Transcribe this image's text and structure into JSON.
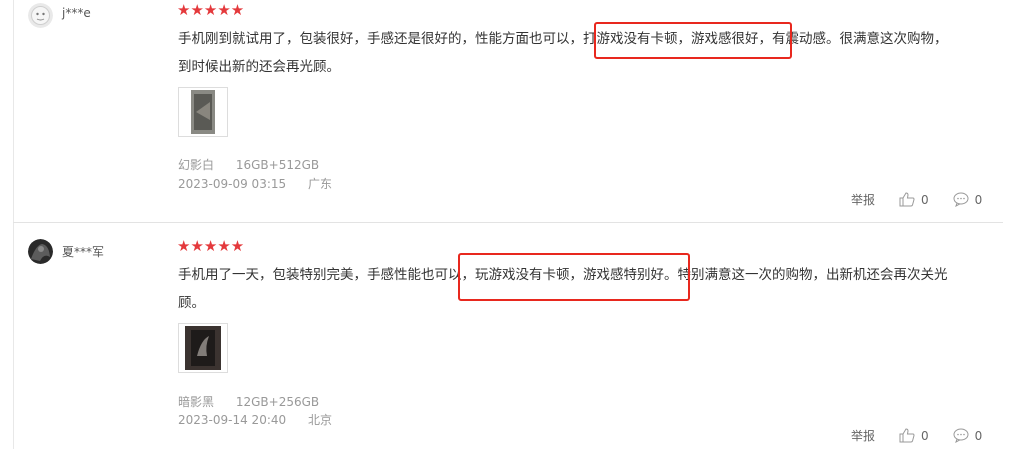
{
  "reviews": [
    {
      "username": "j***e",
      "stars": "★★★★★",
      "content_line1": "手机刚到就试用了，包装很好，手感还是很好的，性能方面也可以，打游戏没有卡顿，游戏感很好，有震动感。很满意这次购物，",
      "content_line2": "到时候出新的还会再光顾。",
      "variant_color": "幻影白",
      "variant_spec": "16GB+512GB",
      "date": "2023-09-09 03:15",
      "location": "广东",
      "report_label": "举报",
      "like_count": "0",
      "comment_count": "0"
    },
    {
      "username": "夏***军",
      "stars": "★★★★★",
      "content_line1": "手机用了一天，包装特别完美，手感性能也可以，玩游戏没有卡顿，游戏感特别好。特别满意这一次的购物，出新机还会再次关光",
      "content_line2": "顾。",
      "variant_color": "暗影黑",
      "variant_spec": "12GB+256GB",
      "date": "2023-09-14 20:40",
      "location": "北京",
      "report_label": "举报",
      "like_count": "0",
      "comment_count": "0"
    }
  ],
  "colors": {
    "star": "#e4393c",
    "highlight": "#e8281e"
  },
  "icons": {
    "like": "thumbs-up-icon",
    "comment": "comment-bubble-icon"
  }
}
